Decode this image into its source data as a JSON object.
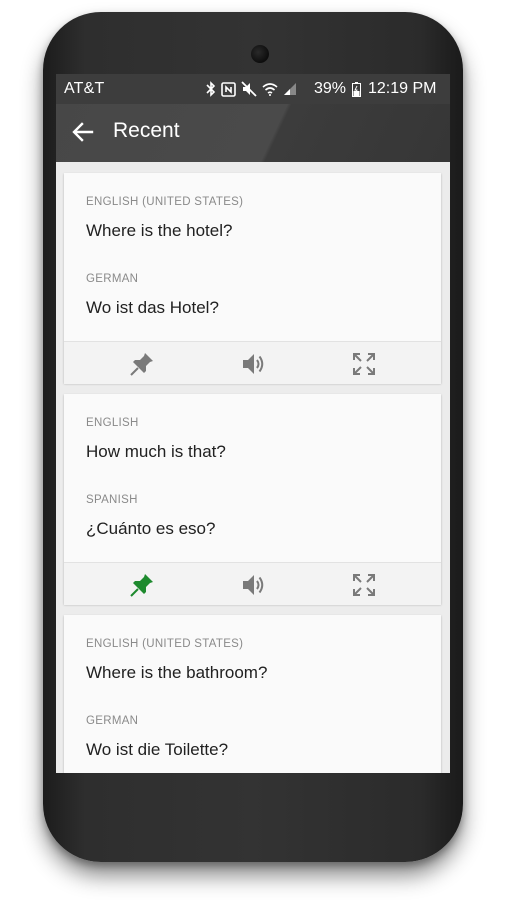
{
  "status_bar": {
    "carrier": "AT&T",
    "battery_percent": "39%",
    "time": "12:19 PM",
    "icons": [
      "bluetooth-icon",
      "nfc-icon",
      "mute-icon",
      "wifi-icon",
      "signal-icon",
      "battery-icon"
    ]
  },
  "app_bar": {
    "title": "Recent",
    "back_icon": "arrow-back-icon"
  },
  "cards": [
    {
      "source_lang": "ENGLISH (UNITED STATES)",
      "source_text": "Where is the hotel?",
      "target_lang": "GERMAN",
      "target_text": "Wo ist das Hotel?",
      "pinned": false,
      "actions": [
        "pin-icon",
        "speaker-icon",
        "fullscreen-icon"
      ]
    },
    {
      "source_lang": "ENGLISH",
      "source_text": "How much is that?",
      "target_lang": "SPANISH",
      "target_text": "¿Cuánto es eso?",
      "pinned": true,
      "actions": [
        "pin-icon",
        "speaker-icon",
        "fullscreen-icon"
      ]
    },
    {
      "source_lang": "ENGLISH (UNITED STATES)",
      "source_text": "Where is the bathroom?",
      "target_lang": "GERMAN",
      "target_text": "Wo ist die Toilette?"
    }
  ],
  "colors": {
    "pin_active": "#1e8a2e",
    "icon_inactive": "#7a7a7a",
    "app_bar": "#474747",
    "status_bar": "#3d3d3d"
  }
}
